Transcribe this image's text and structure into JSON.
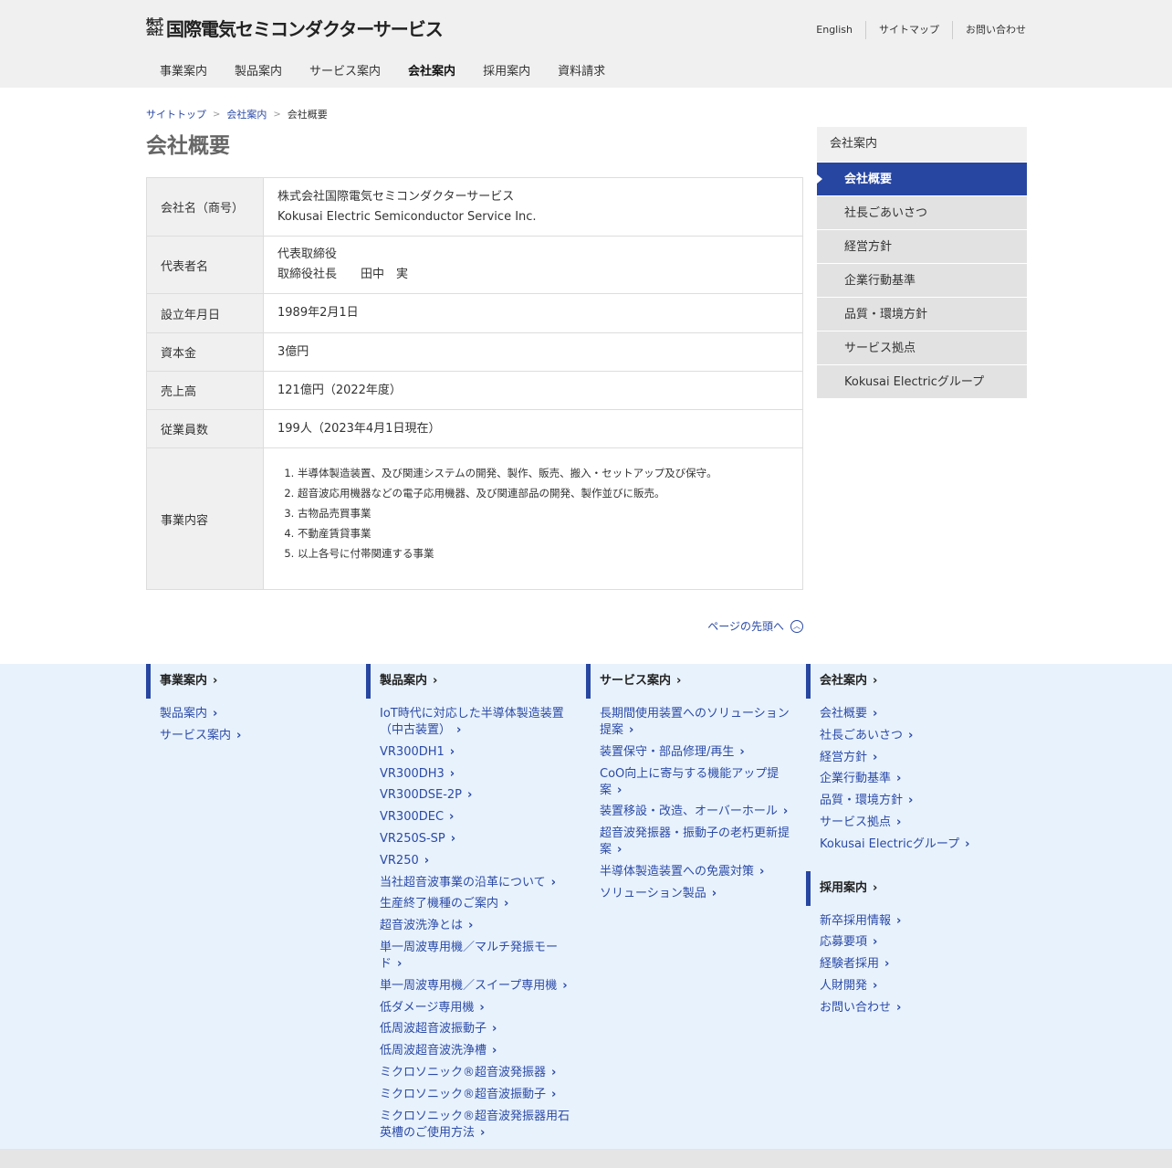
{
  "header": {
    "logo_kabushiki": "株式会社",
    "logo_name": "国際電気セミコンダクターサービス",
    "util_links": [
      "English",
      "サイトマップ",
      "お問い合わせ"
    ],
    "gnav": [
      "事業案内",
      "製品案内",
      "サービス案内",
      "会社案内",
      "採用案内",
      "資料請求"
    ],
    "gnav_active": "会社案内"
  },
  "breadcrumb": {
    "home": "サイトトップ",
    "parent": "会社案内",
    "current": "会社概要",
    "separator": ">"
  },
  "page_title": "会社概要",
  "company_table": [
    {
      "label": "会社名（商号）",
      "lines": [
        "株式会社国際電気セミコンダクターサービス",
        "Kokusai Electric Semiconductor Service Inc."
      ]
    },
    {
      "label": "代表者名",
      "lines": [
        "代表取締役",
        "取締役社長　　田中　実"
      ]
    },
    {
      "label": "設立年月日",
      "lines": [
        "1989年2月1日"
      ]
    },
    {
      "label": "資本金",
      "lines": [
        "3億円"
      ]
    },
    {
      "label": "売上高",
      "lines": [
        "121億円（2022年度）"
      ]
    },
    {
      "label": "従業員数",
      "lines": [
        "199人（2023年4月1日現在）"
      ]
    },
    {
      "label": "事業内容",
      "items": [
        "半導体製造装置、及び関連システムの開発、製作、販売、搬入・セットアップ及び保守。",
        "超音波応用機器などの電子応用機器、及び関連部品の開発、製作並びに販売。",
        "古物品売買事業",
        "不動産賃貸事業",
        "以上各号に付帯関連する事業"
      ]
    }
  ],
  "to_top": {
    "label": "ページの先頭へ",
    "icon": "chevron-up-circle-icon"
  },
  "side_nav": {
    "head": "会社案内",
    "items": [
      "会社概要",
      "社長ごあいさつ",
      "経営方針",
      "企業行動基準",
      "品質・環境方針",
      "サービス拠点",
      "Kokusai Electricグループ"
    ],
    "active": "会社概要"
  },
  "footer_nav": [
    {
      "head": "事業案内",
      "links": [
        "製品案内",
        "サービス案内"
      ]
    },
    {
      "head": "製品案内",
      "links": [
        "IoT時代に対応した半導体製造装置（中古装置）",
        "VR300DH1",
        "VR300DH3",
        "VR300DSE-2P",
        "VR300DEC",
        "VR250S-SP",
        "VR250",
        "当社超音波事業の沿革について",
        "生産終了機種のご案内",
        "超音波洗浄とは",
        "単一周波専用機／マルチ発振モード",
        "単一周波専用機／スイープ専用機",
        "低ダメージ専用機",
        "低周波超音波振動子",
        "低周波超音波洗浄槽",
        "ミクロソニック®超音波発振器",
        "ミクロソニック®超音波振動子",
        "ミクロソニック®超音波発振器用石英槽のご使用方法"
      ]
    },
    {
      "head": "サービス案内",
      "links": [
        "長期間使用装置へのソリューション提案",
        "装置保守・部品修理/再生",
        "CoO向上に寄与する機能アップ提案",
        "装置移設・改造、オーバーホール",
        "超音波発振器・振動子の老朽更新提案",
        "半導体製造装置への免震対策",
        "ソリューション製品"
      ]
    },
    {
      "head": "会社案内",
      "links": [
        "会社概要",
        "社長ごあいさつ",
        "経営方針",
        "企業行動基準",
        "品質・環境方針",
        "サービス拠点",
        "Kokusai Electricグループ"
      ]
    },
    {
      "head": "採用案内",
      "links": [
        "新卒採用情報",
        "応募要項",
        "経験者採用",
        "人財開発",
        "お問い合わせ"
      ]
    }
  ],
  "colors": {
    "accent": "#2746a2",
    "link": "#2b4aa6",
    "header_bg": "#f0f0f0",
    "footer_bg": "#e8f2fc"
  }
}
